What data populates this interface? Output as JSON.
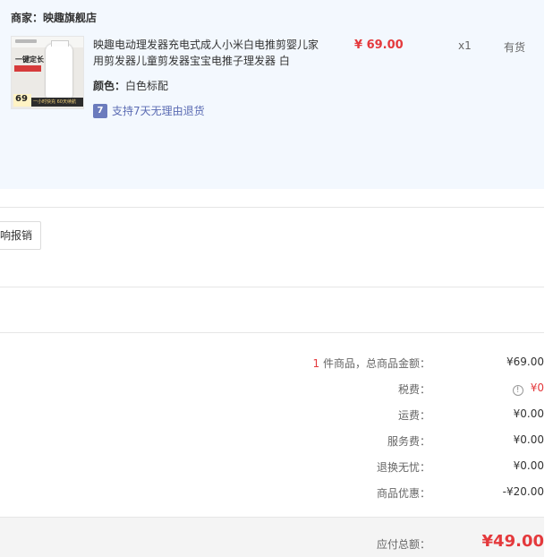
{
  "merchant": {
    "label": "商家：",
    "name": "映趣旗舰店"
  },
  "product": {
    "title": "映趣电动理发器充电式成人小米白电推剪婴儿家用剪发器儿童剪发器宝宝电推子理发器 白",
    "color_label": "颜色：",
    "color_value": "白色标配",
    "return_policy": "支持7天无理由退货",
    "return_icon": "7",
    "price": "¥ 69.00",
    "quantity": "x1",
    "stock": "有货",
    "thumbnail_text": {
      "headline": "一键定长",
      "price": "69",
      "banner": "一小时快充 60天续航"
    }
  },
  "invoice": {
    "button_label": "响报销"
  },
  "summary": {
    "rows": [
      {
        "count": "1",
        "label": " 件商品，总商品金额：",
        "value": "¥69.00"
      },
      {
        "label": "税费：",
        "value": "¥0"
      },
      {
        "label": "运费：",
        "value": "¥0.00"
      },
      {
        "label": "服务费：",
        "value": "¥0.00"
      },
      {
        "label": "退换无忧：",
        "value": "¥0.00"
      },
      {
        "label": "商品优惠：",
        "value": "-¥20.00"
      }
    ],
    "tax_info_icon": "info-icon"
  },
  "total": {
    "label": "应付总额：",
    "value": "¥49.00"
  },
  "colors": {
    "accent_red": "#e4393c",
    "panel_bg": "#f3f8fe",
    "link_blue": "#5b6bb3"
  }
}
